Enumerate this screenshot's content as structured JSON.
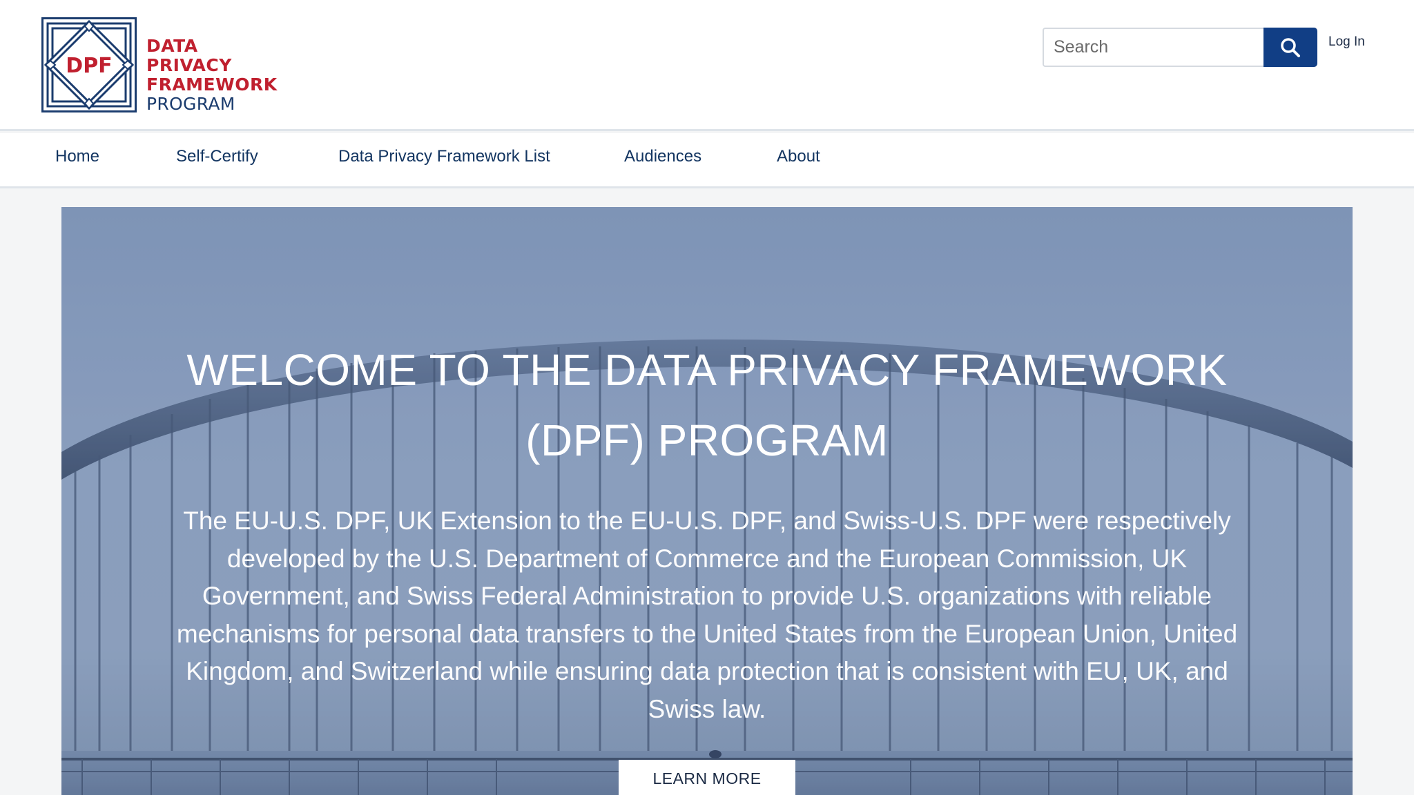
{
  "logo": {
    "mark_text": "DPF",
    "line1": "DATA PRIVACY",
    "line2": "FRAMEWORK",
    "line3": "PROGRAM"
  },
  "header": {
    "search_placeholder": "Search",
    "login_label": "Log In"
  },
  "nav": {
    "items": [
      {
        "label": "Home"
      },
      {
        "label": "Self-Certify"
      },
      {
        "label": "Data Privacy Framework List"
      },
      {
        "label": "Audiences"
      },
      {
        "label": "About"
      }
    ]
  },
  "hero": {
    "title": "WELCOME TO THE DATA PRIVACY FRAMEWORK (DPF) PROGRAM",
    "description": "The EU-U.S. DPF, UK Extension to the EU-U.S. DPF, and Swiss-U.S. DPF were respectively developed by the U.S. Department of Commerce and the European Commission, UK Government, and Swiss Federal Administration to provide U.S. organizations with reliable mechanisms for personal data transfers to the United States from the European Union, United Kingdom, and Switzerland while ensuring data protection that is consistent with EU, UK, and Swiss law.",
    "button_label": "LEARN MORE"
  },
  "colors": {
    "brand_red": "#c0202f",
    "brand_navy": "#1b3c6e",
    "search_button": "#113e85",
    "nav_text": "#133561"
  },
  "icons": {
    "search": "search-icon",
    "logo_mark": "dpf-logo-mark"
  }
}
